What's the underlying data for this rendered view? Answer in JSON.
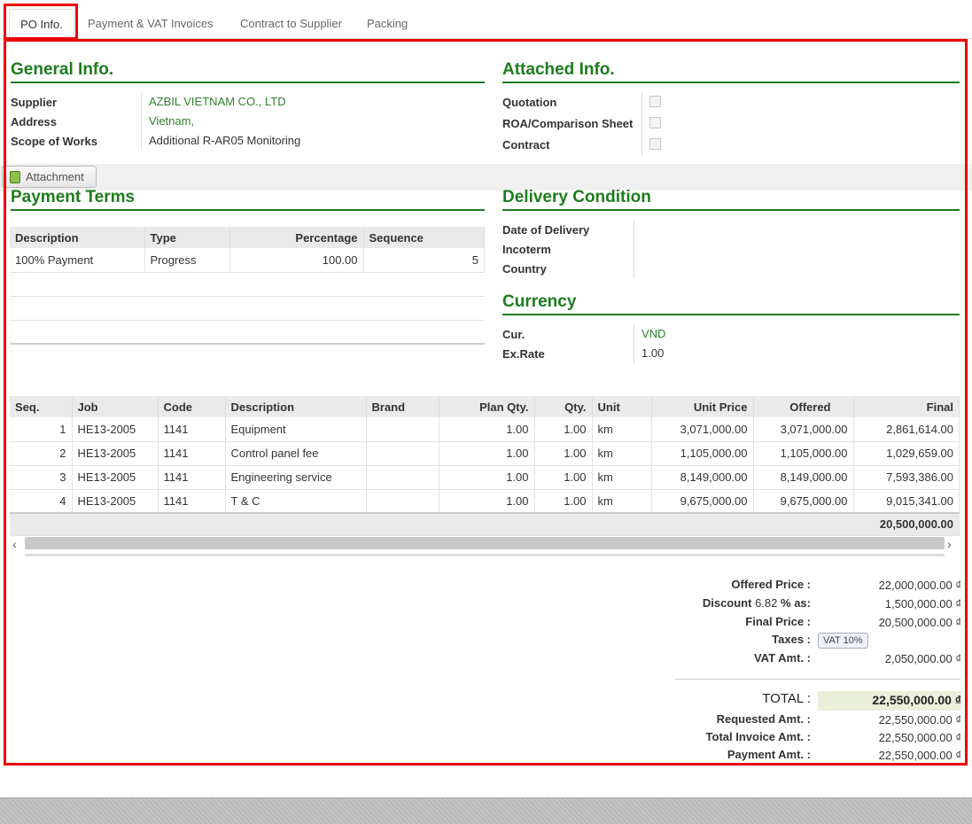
{
  "tabs": [
    "PO Info.",
    "Payment & VAT Invoices",
    "Contract to Supplier",
    "Packing"
  ],
  "general": {
    "title": "General Info.",
    "supplier_label": "Supplier",
    "supplier": "AZBIL VIETNAM CO., LTD",
    "address_label": "Address",
    "address": "Vietnam,",
    "scope_label": "Scope of Works",
    "scope": "Additional R-AR05 Monitoring"
  },
  "attached": {
    "title": "Attached Info.",
    "items": [
      "Quotation",
      "ROA/Comparison Sheet",
      "Contract"
    ]
  },
  "attachment_button": "Attachment",
  "payment_terms": {
    "title": "Payment Terms",
    "headers": [
      "Description",
      "Type",
      "Percentage",
      "Sequence"
    ],
    "rows": [
      [
        "100% Payment",
        "Progress",
        "100.00",
        "5"
      ]
    ]
  },
  "delivery": {
    "title": "Delivery Condition",
    "labels": [
      "Date of Delivery",
      "Incoterm",
      "Country"
    ]
  },
  "currency": {
    "title": "Currency",
    "cur_label": "Cur.",
    "cur": "VND",
    "rate_label": "Ex.Rate",
    "rate": "1.00"
  },
  "lines": {
    "headers": [
      "Seq.",
      "Job",
      "Code",
      "Description",
      "Brand",
      "Plan Qty.",
      "Qty.",
      "Unit",
      "Unit Price",
      "Offered",
      "Final"
    ],
    "rows": [
      [
        "1",
        "HE13-2005",
        "1141",
        "Equipment",
        "",
        "1.00",
        "1.00",
        "km",
        "3,071,000.00",
        "3,071,000.00",
        "2,861,614.00"
      ],
      [
        "2",
        "HE13-2005",
        "1141",
        "Control panel fee",
        "",
        "1.00",
        "1.00",
        "km",
        "1,105,000.00",
        "1,105,000.00",
        "1,029,659.00"
      ],
      [
        "3",
        "HE13-2005",
        "1141",
        "Engineering service",
        "",
        "1.00",
        "1.00",
        "km",
        "8,149,000.00",
        "8,149,000.00",
        "7,593,386.00"
      ],
      [
        "4",
        "HE13-2005",
        "1141",
        "T & C",
        "",
        "1.00",
        "1.00",
        "km",
        "9,675,000.00",
        "9,675,000.00",
        "9,015,341.00"
      ]
    ],
    "total": "20,500,000.00"
  },
  "summary": {
    "offered_label": "Offered Price :",
    "offered": "22,000,000.00 ₫",
    "discount_label": "Discount",
    "discount_pct": "6.82",
    "discount_suffix": "% as:",
    "discount": "1,500,000.00 ₫",
    "final_label": "Final Price :",
    "final": "20,500,000.00 ₫",
    "taxes_label": "Taxes :",
    "tax_tag": "VAT 10%",
    "vat_label": "VAT Amt. :",
    "vat": "2,050,000.00 ₫",
    "total_label": "TOTAL :",
    "total": "22,550,000.00 ₫",
    "requested_label": "Requested Amt. :",
    "requested": "22,550,000.00 ₫",
    "invoice_label": "Total Invoice Amt. :",
    "invoice": "22,550,000.00 ₫",
    "payment_label": "Payment Amt. :",
    "payment": "22,550,000.00 ₫"
  },
  "colors": {
    "accent": "#1d7d1d",
    "highlight": "#e00000"
  }
}
